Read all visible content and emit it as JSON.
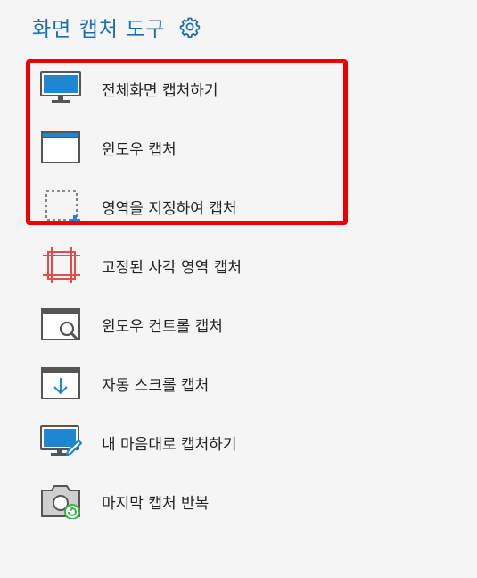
{
  "header": {
    "title": "화면 캡처 도구",
    "settings_icon": "gear-icon"
  },
  "menu": {
    "items": [
      {
        "label": "전체화면 캡처하기",
        "icon": "monitor-icon"
      },
      {
        "label": "윈도우 캡처",
        "icon": "window-icon"
      },
      {
        "label": "영역을 지정하여 캡처",
        "icon": "region-select-icon"
      },
      {
        "label": "고정된 사각 영역 캡처",
        "icon": "fixed-rect-icon"
      },
      {
        "label": "윈도우 컨트롤 캡처",
        "icon": "window-control-icon"
      },
      {
        "label": "자동 스크롤 캡처",
        "icon": "auto-scroll-icon"
      },
      {
        "label": "내 마음대로 캡처하기",
        "icon": "freehand-icon"
      },
      {
        "label": "마지막 캡처 반복",
        "icon": "repeat-capture-icon"
      }
    ],
    "highlighted_count": 3
  },
  "colors": {
    "accent": "#1a6fb5",
    "highlight_border": "#ee0000",
    "icon_blue": "#1f86d2",
    "icon_red": "#e84a4a",
    "icon_green": "#3bb54a"
  }
}
